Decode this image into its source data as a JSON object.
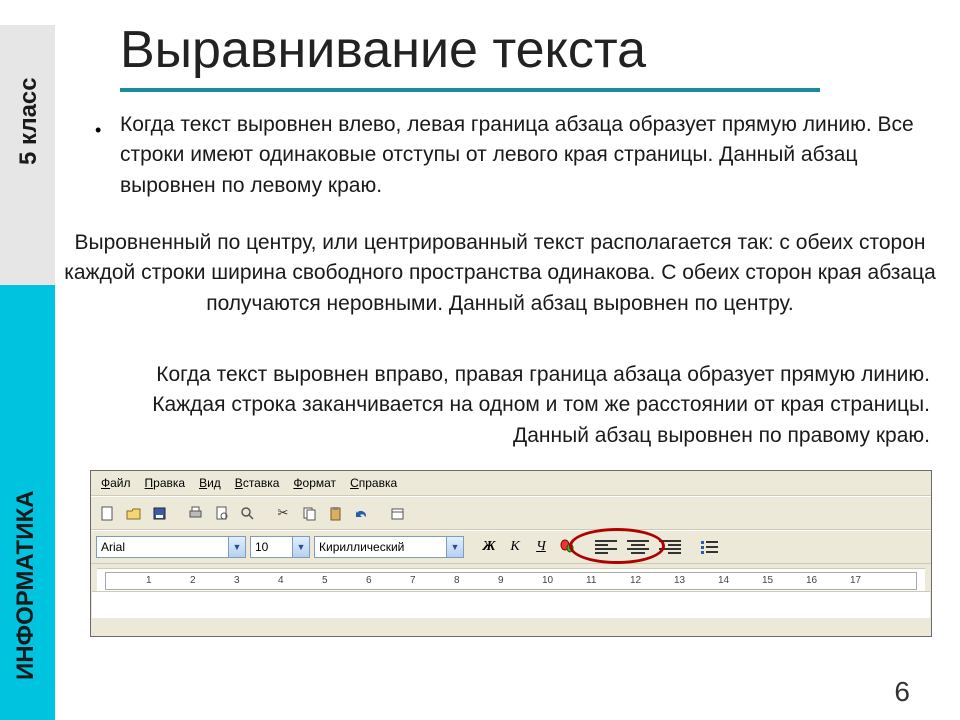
{
  "sidebar": {
    "top": "5 класс",
    "bottom": "ИНФОРМАТИКА"
  },
  "title": "Выравнивание текста",
  "paragraphs": {
    "p1": "Когда текст выровнен влево, левая граница абзаца образует прямую линию. Все строки имеют одинаковые отступы от левого края страницы. Данный абзац выровнен по левому краю.",
    "p2": "Выровненный по центру, или центрированный текст располагается так: с обеих сторон каждой строки ширина свободного пространства одинакова. С обеих сторон края абзаца получаются неровными. Данный абзац выровнен по центру.",
    "p3": "Когда текст выровнен вправо, правая граница абзаца образует прямую линию. Каждая строка заканчивается на одном и том же расстоянии от края страницы. Данный абзац выровнен по правому краю."
  },
  "app": {
    "menu": [
      "Файл",
      "Правка",
      "Вид",
      "Вставка",
      "Формат",
      "Справка"
    ],
    "font": "Arial",
    "fontSize": "10",
    "charset": "Кириллический",
    "fmt": {
      "bold": "Ж",
      "italic": "К",
      "under": "Ч"
    },
    "ruler": [
      "1",
      "2",
      "3",
      "4",
      "5",
      "6",
      "7",
      "8",
      "9",
      "10",
      "11",
      "12",
      "13",
      "14",
      "15",
      "16",
      "17"
    ]
  },
  "pageNumber": "6"
}
